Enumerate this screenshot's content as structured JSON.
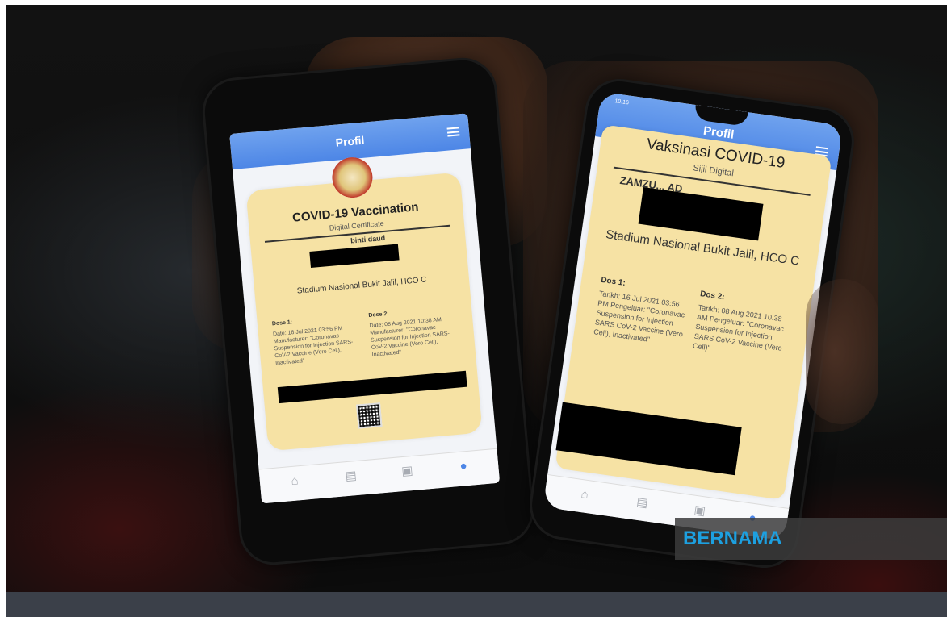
{
  "watermark": "BERNAMA",
  "phone_left": {
    "header_title": "Profil",
    "card_title": "COVID-19 Vaccination",
    "card_subtitle": "Digital Certificate",
    "name_partial": "binti daud",
    "location": "Stadium Nasional Bukit Jalil, HCO C",
    "dose1_label": "Dose 1:",
    "dose2_label": "Dose 2:",
    "dose1_details": "Date: 16 Jul 2021 03:56 PM Manufacturer: \"Coronavac Suspension for Injection SARS-CoV-2 Vaccine (Vero Cell), Inactivated\"",
    "dose2_details": "Date: 08 Aug 2021 10:38 AM Manufacturer: \"Coronavac Suspension for Injection SARS-CoV-2 Vaccine (Vero Cell), Inactivated\""
  },
  "phone_right": {
    "header_title": "Profil",
    "status_time": "10:16",
    "card_title": "Vaksinasi COVID-19",
    "card_subtitle": "Sijil Digital",
    "name_partial": "ZAMZU... AD",
    "location": "Stadium Nasional Bukit Jalil, HCO C",
    "dose1_label": "Dos 1:",
    "dose2_label": "Dos 2:",
    "dose1_details": "Tarikh: 16 Jul 2021 03:56 PM Pengeluar: \"Coronavac Suspension for Injection SARS CoV-2 Vaccine (Vero Cell), Inactivated\"",
    "dose2_details": "Tarikh: 08 Aug 2021 10:38 AM Pengeluar: \"Coronavac Suspension for Injection SARS CoV-2 Vaccine (Vero Cell)\""
  },
  "colors": {
    "header_blue": "#5b93ea",
    "card_yellow": "#f6e2a4",
    "watermark_text": "#1da0e0",
    "bottom_bar": "#3b4049"
  }
}
